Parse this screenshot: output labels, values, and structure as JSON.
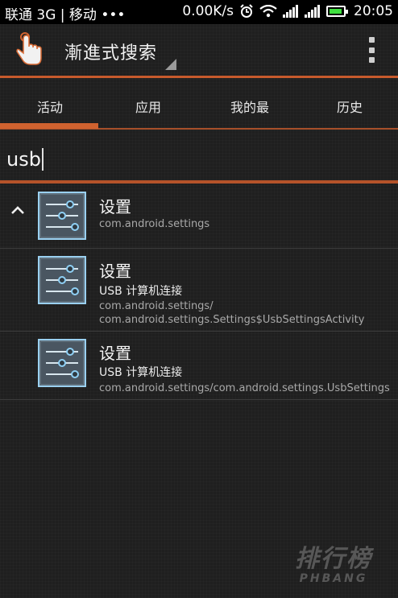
{
  "status_bar": {
    "carrier": "联通 3G | 移动 •••",
    "speed": "0.00K/s",
    "time": "20:05",
    "icons": [
      "alarm-icon",
      "wifi-icon",
      "signal-icon",
      "signal-icon",
      "battery-icon"
    ]
  },
  "action_bar": {
    "title": "漸進式搜索",
    "app_icon": "hand-pointer-icon",
    "menu_icon": "overflow-menu-icon"
  },
  "tabs": [
    {
      "label": "活动",
      "selected": true
    },
    {
      "label": "应用",
      "selected": false
    },
    {
      "label": "我的最",
      "selected": false
    },
    {
      "label": "历史",
      "selected": false
    }
  ],
  "search": {
    "query": "usb"
  },
  "results": [
    {
      "title": "设置",
      "subtitle": "",
      "package_lines": [
        "com.android.settings"
      ],
      "icon": "settings-sliders-icon",
      "expanded": true
    },
    {
      "title": "设置",
      "subtitle": "USB 计算机连接",
      "package_lines": [
        "com.android.settings/",
        "com.android.settings.Settings$UsbSettingsActivity"
      ],
      "icon": "settings-sliders-icon"
    },
    {
      "title": "设置",
      "subtitle": "USB 计算机连接",
      "package_lines": [
        "com.android.settings/com.android.settings.UsbSettings"
      ],
      "icon": "settings-sliders-icon"
    }
  ],
  "watermark": {
    "main": "排行榜",
    "sub": "PHBANG"
  },
  "colors": {
    "accent": "#d0622f",
    "background": "#1f1f1f",
    "battery": "#3fe03f"
  }
}
